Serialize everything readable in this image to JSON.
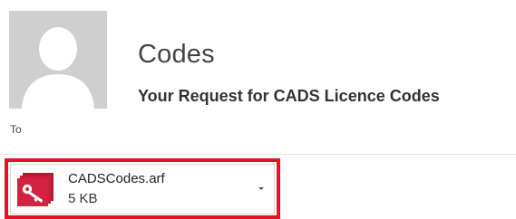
{
  "message": {
    "sender": "Codes",
    "subject": "Your Request for CADS Licence Codes",
    "to_label": "To"
  },
  "attachment": {
    "name": "CADSCodes.arf",
    "size": "5 KB",
    "icon": "key-file-icon"
  },
  "colors": {
    "highlight": "#e81123",
    "attachment_icon": "#d4233f",
    "avatar_bg": "#cfcfcf"
  },
  "icons": {
    "avatar": "person-silhouette-icon",
    "dropdown": "chevron-down-icon"
  }
}
